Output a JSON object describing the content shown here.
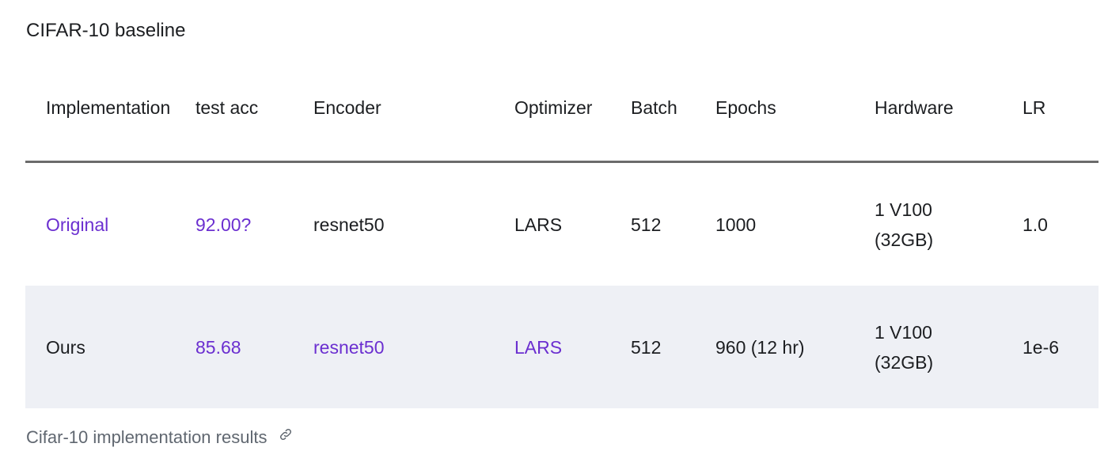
{
  "page": {
    "title": "CIFAR-10 baseline"
  },
  "table": {
    "headers": [
      "Implementation",
      "test acc",
      "Encoder",
      "Optimizer",
      "Batch",
      "Epochs",
      "Hardware",
      "LR"
    ],
    "rows": [
      {
        "implementation": "Original",
        "test_acc": "92.00?",
        "encoder": "resnet50",
        "optimizer": "LARS",
        "batch": "512",
        "epochs": "1000",
        "hardware_line1": "1 V100",
        "hardware_line2": "(32GB)",
        "lr": "1.0"
      },
      {
        "implementation": "Ours",
        "test_acc": "85.68",
        "encoder": "resnet50",
        "optimizer": "LARS",
        "batch": "512",
        "epochs": "960 (12 hr)",
        "hardware_line1": "1 V100",
        "hardware_line2": "(32GB)",
        "lr": "1e-6"
      }
    ]
  },
  "caption": {
    "text": "Cifar-10 implementation results",
    "icon": "link-icon"
  },
  "colors": {
    "link": "#6b2fd0",
    "shaded_row": "#eef0f5",
    "header_rule": "#6b6b6b",
    "caption_text": "#606770"
  }
}
